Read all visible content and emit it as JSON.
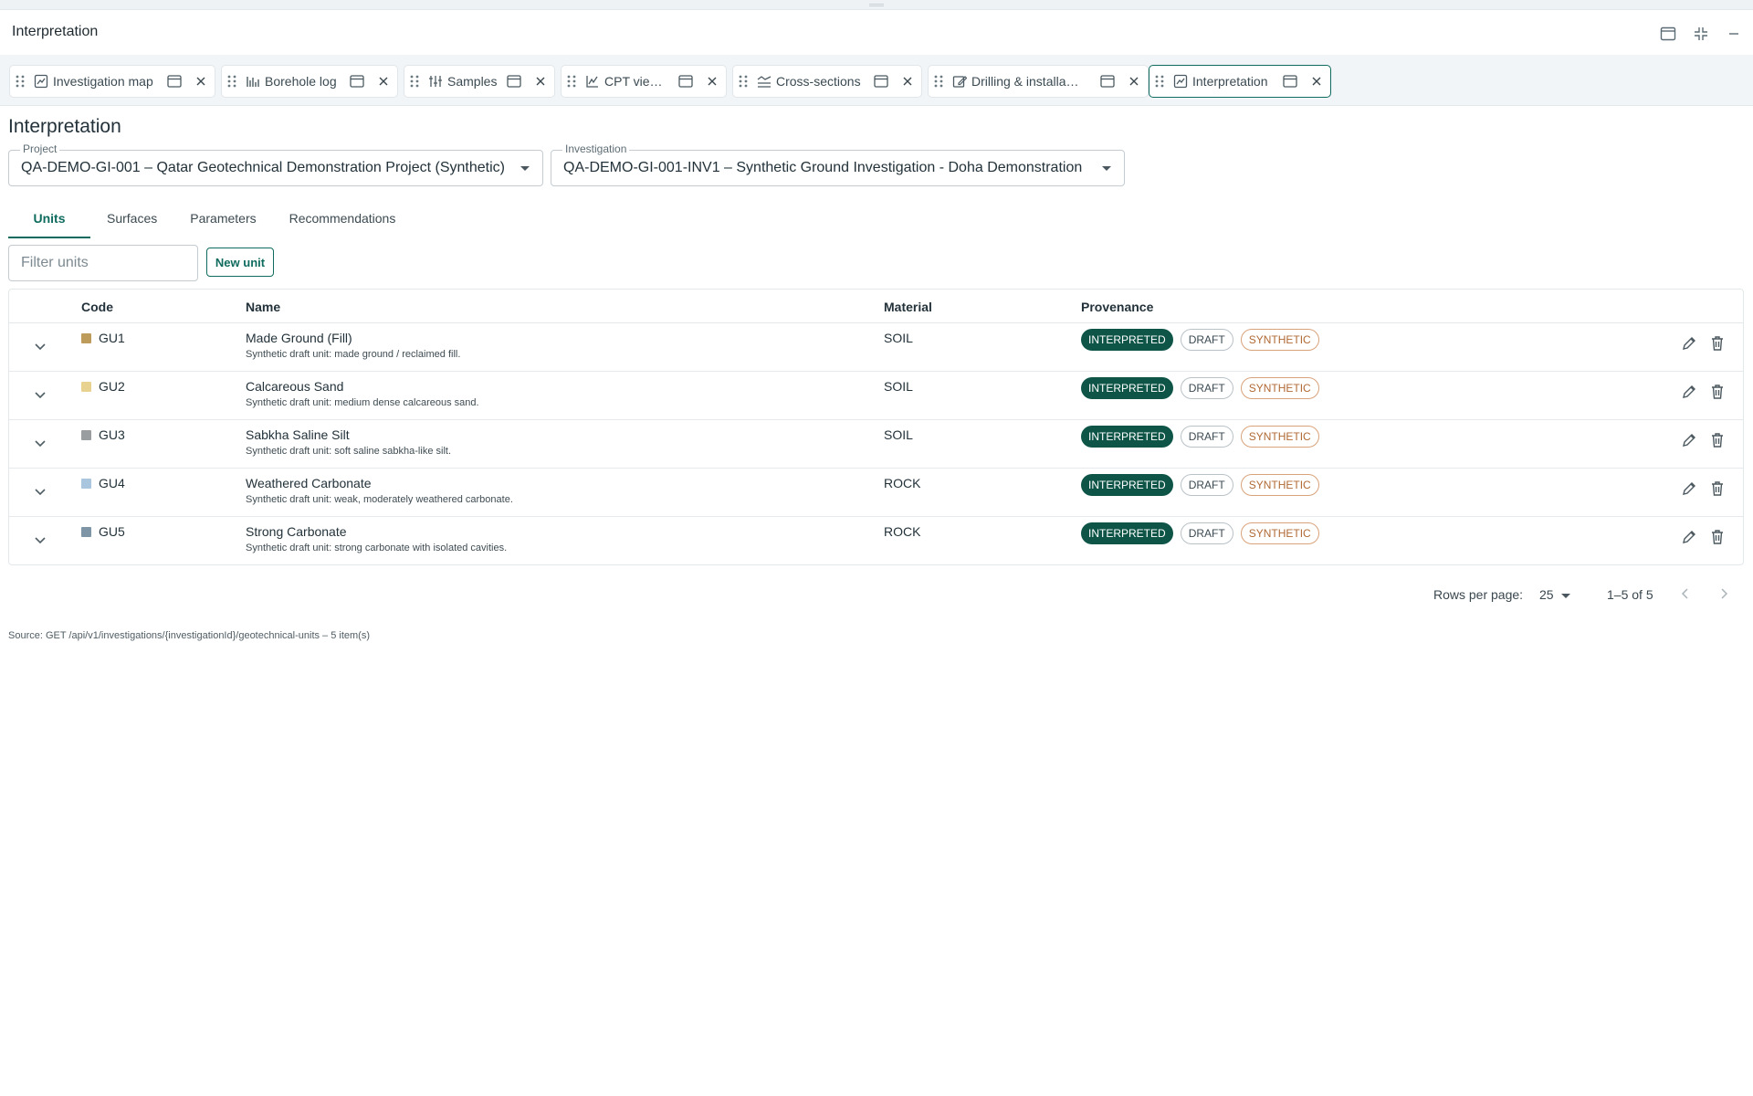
{
  "window": {
    "title": "Interpretation"
  },
  "workspace_tabs": [
    {
      "label": "Investigation map",
      "icon": "map-chart-icon"
    },
    {
      "label": "Borehole log",
      "icon": "bar-chart-icon"
    },
    {
      "label": "Samples",
      "icon": "samples-icon"
    },
    {
      "label": "CPT viewer",
      "icon": "line-chart-icon"
    },
    {
      "label": "Cross-sections",
      "icon": "cross-section-icon"
    },
    {
      "label": "Drilling & installa…",
      "icon": "drawing-icon"
    },
    {
      "label": "Interpretation",
      "icon": "map-chart-icon",
      "active": true
    }
  ],
  "page": {
    "title": "Interpretation",
    "project_label": "Project",
    "project_value": "QA-DEMO-GI-001 – Qatar Geotechnical Demonstration Project (Synthetic)",
    "investigation_label": "Investigation",
    "investigation_value": "QA-DEMO-GI-001-INV1 – Synthetic Ground Investigation - Doha Demonstration"
  },
  "tabs": {
    "units": "Units",
    "surfaces": "Surfaces",
    "parameters": "Parameters",
    "recommendations": "Recommendations"
  },
  "toolbar": {
    "filter_placeholder": "Filter units",
    "new_unit": "New unit"
  },
  "table": {
    "headers": {
      "code": "Code",
      "name": "Name",
      "material": "Material",
      "provenance": "Provenance"
    },
    "rows": [
      {
        "code": "GU1",
        "color": "#bd9b5a",
        "name": "Made Ground (Fill)",
        "desc": "Synthetic draft unit: made ground / reclaimed fill.",
        "material": "SOIL",
        "chips": [
          "INTERPRETED",
          "DRAFT",
          "SYNTHETIC"
        ]
      },
      {
        "code": "GU2",
        "color": "#e8d28f",
        "name": "Calcareous Sand",
        "desc": "Synthetic draft unit: medium dense calcareous sand.",
        "material": "SOIL",
        "chips": [
          "INTERPRETED",
          "DRAFT",
          "SYNTHETIC"
        ]
      },
      {
        "code": "GU3",
        "color": "#9a9d9f",
        "name": "Sabkha Saline Silt",
        "desc": "Synthetic draft unit: soft saline sabkha-like silt.",
        "material": "SOIL",
        "chips": [
          "INTERPRETED",
          "DRAFT",
          "SYNTHETIC"
        ]
      },
      {
        "code": "GU4",
        "color": "#a9c6de",
        "name": "Weathered Carbonate",
        "desc": "Synthetic draft unit: weak, moderately weathered carbonate.",
        "material": "ROCK",
        "chips": [
          "INTERPRETED",
          "DRAFT",
          "SYNTHETIC"
        ]
      },
      {
        "code": "GU5",
        "color": "#7d95a5",
        "name": "Strong Carbonate",
        "desc": "Synthetic draft unit: strong carbonate with isolated cavities.",
        "material": "ROCK",
        "chips": [
          "INTERPRETED",
          "DRAFT",
          "SYNTHETIC"
        ]
      }
    ]
  },
  "pagination": {
    "rows_per_page_label": "Rows per page:",
    "rows_per_page": "25",
    "range": "1–5 of 5"
  },
  "footer": {
    "source": "Source: GET /api/v1/investigations/{investigationId}/geotechnical-units – 5 item(s)"
  },
  "colors": {
    "accent": "#0f6b5e",
    "interpreted_chip": "#0e5548",
    "synthetic_chip": "#b06a35"
  }
}
